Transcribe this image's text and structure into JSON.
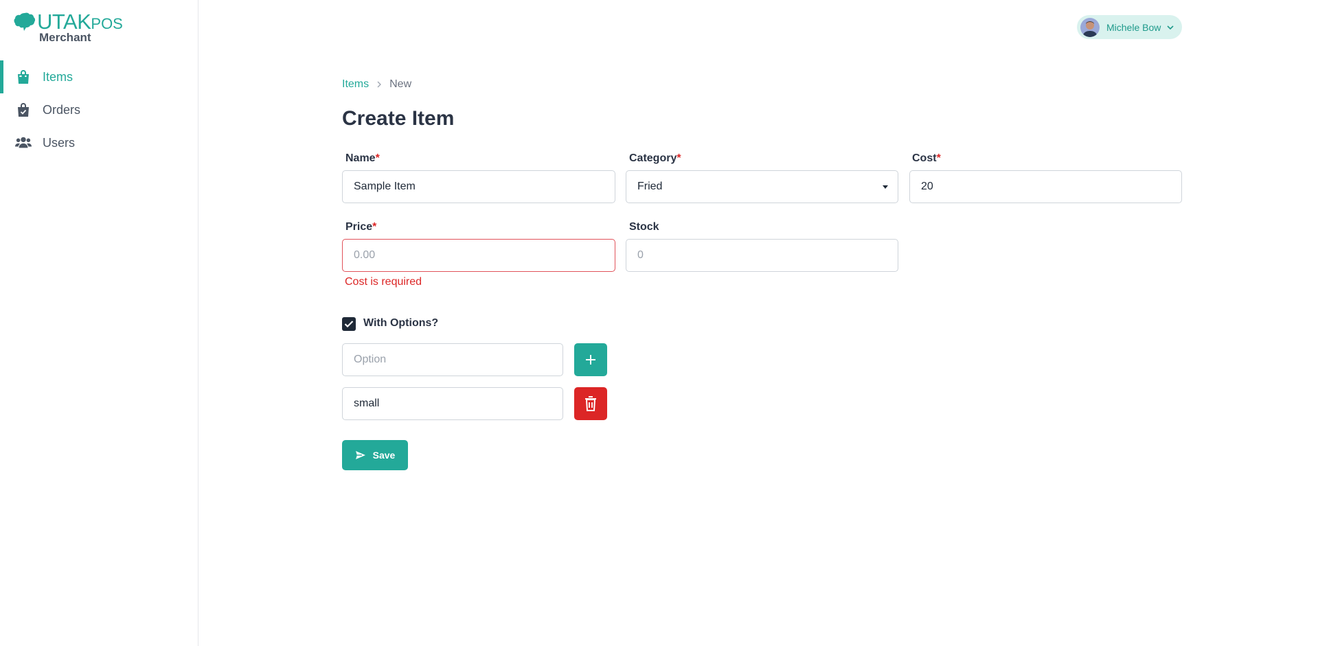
{
  "app": {
    "brand_main": "UTAK",
    "brand_pos": "POS",
    "brand_sub": "Merchant"
  },
  "sidebar": {
    "items": [
      {
        "label": "Items",
        "icon": "shopping-bag-icon",
        "active": true
      },
      {
        "label": "Orders",
        "icon": "bag-check-icon",
        "active": false
      },
      {
        "label": "Users",
        "icon": "users-icon",
        "active": false
      }
    ]
  },
  "user": {
    "name": "Michele Bow"
  },
  "breadcrumb": {
    "parent": "Items",
    "current": "New"
  },
  "page": {
    "title": "Create Item"
  },
  "form": {
    "name": {
      "label": "Name",
      "required": "*",
      "value": "Sample Item"
    },
    "category": {
      "label": "Category",
      "required": "*",
      "value": "Fried"
    },
    "cost": {
      "label": "Cost",
      "required": "*",
      "value": "20"
    },
    "price": {
      "label": "Price",
      "required": "*",
      "value": "",
      "placeholder": "0.00",
      "error": "Cost is required"
    },
    "stock": {
      "label": "Stock",
      "value": "",
      "placeholder": "0"
    },
    "with_options": {
      "label": "With Options?",
      "checked": true
    },
    "new_option": {
      "value": "",
      "placeholder": "Option"
    },
    "options": [
      {
        "value": "small"
      }
    ],
    "save_label": "Save"
  },
  "colors": {
    "accent": "#23a999",
    "danger": "#dc2626",
    "text_dark": "#2b3445"
  }
}
